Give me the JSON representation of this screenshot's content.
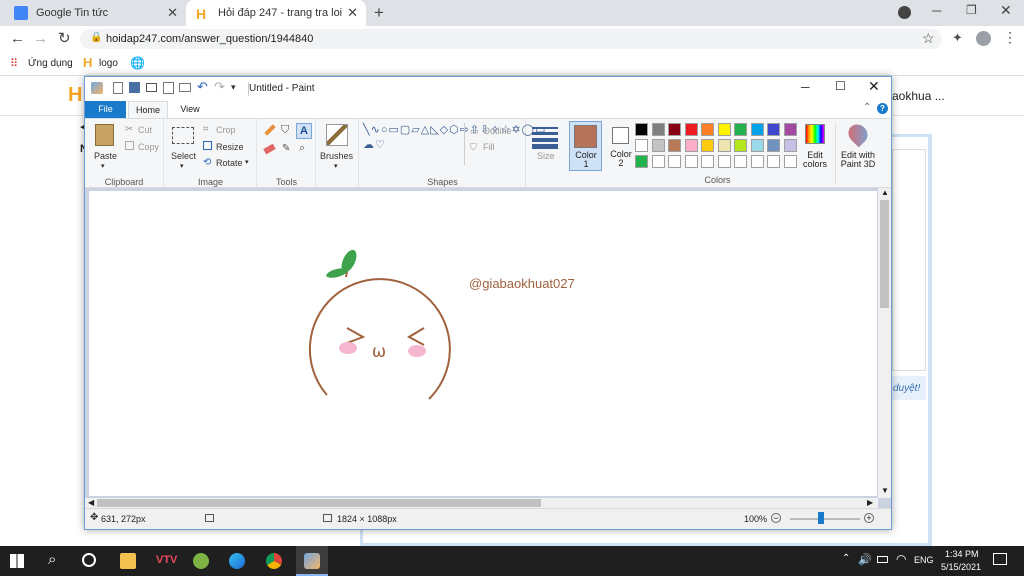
{
  "browser": {
    "tabs": [
      {
        "title": "Google Tin tức"
      },
      {
        "title": "Hỏi đáp 247 - trang tra loi"
      }
    ],
    "url": "hoidap247.com/answer_question/1944840",
    "bookmarks": [
      {
        "label": "Ứng dụng"
      },
      {
        "label": "logo"
      }
    ],
    "page_snippets": {
      "right_header": "aokhua ...",
      "right_link": "duyệt!"
    }
  },
  "paint": {
    "title": "Untitled - Paint",
    "tabs": {
      "file": "File",
      "home": "Home",
      "view": "View"
    },
    "clipboard": {
      "paste": "Paste",
      "cut": "Cut",
      "copy": "Copy",
      "label": "Clipboard"
    },
    "image": {
      "select": "Select",
      "crop": "Crop",
      "resize": "Resize",
      "rotate": "Rotate",
      "label": "Image"
    },
    "tools": {
      "label": "Tools"
    },
    "brushes": {
      "label": "Brushes"
    },
    "shapes": {
      "outline": "Outline",
      "fill": "Fill",
      "label": "Shapes"
    },
    "size": {
      "label": "Size"
    },
    "color1": {
      "label": "Color\n1",
      "value": "#b7735a"
    },
    "color2": {
      "label": "Color\n2",
      "value": "#ffffff"
    },
    "colors": {
      "label": "Colors",
      "row1": [
        "#000000",
        "#7f7f7f",
        "#880015",
        "#ed1c24",
        "#ff7f27",
        "#fff200",
        "#22b14c",
        "#00a2e8",
        "#3f48cc",
        "#a349a4"
      ],
      "row2": [
        "#ffffff",
        "#c3c3c3",
        "#b97a57",
        "#ffaec9",
        "#ffc90e",
        "#efe4b0",
        "#b5e61d",
        "#99d9ea",
        "#7092be",
        "#c8bfe7"
      ],
      "row3": [
        "#22b14c",
        "#ffffff",
        "#ffffff",
        "#ffffff",
        "#ffffff",
        "#ffffff",
        "#ffffff",
        "#ffffff",
        "#ffffff",
        "#ffffff"
      ]
    },
    "edit_colors": "Edit\ncolors",
    "edit_paint3d": "Edit with\nPaint 3D",
    "drawing": {
      "text": "@giabaokhuat027",
      "mouth": "ω",
      "stroke_color": "#a0623e",
      "leaf_color": "#3fa34d",
      "blush_color": "#f6b6cf"
    },
    "status": {
      "cursor": "631, 272px",
      "dimensions": "1824 × 1088px",
      "zoom": "100%"
    }
  },
  "taskbar": {
    "lang": "ENG",
    "time": "1:34 PM",
    "date": "5/15/2021"
  }
}
